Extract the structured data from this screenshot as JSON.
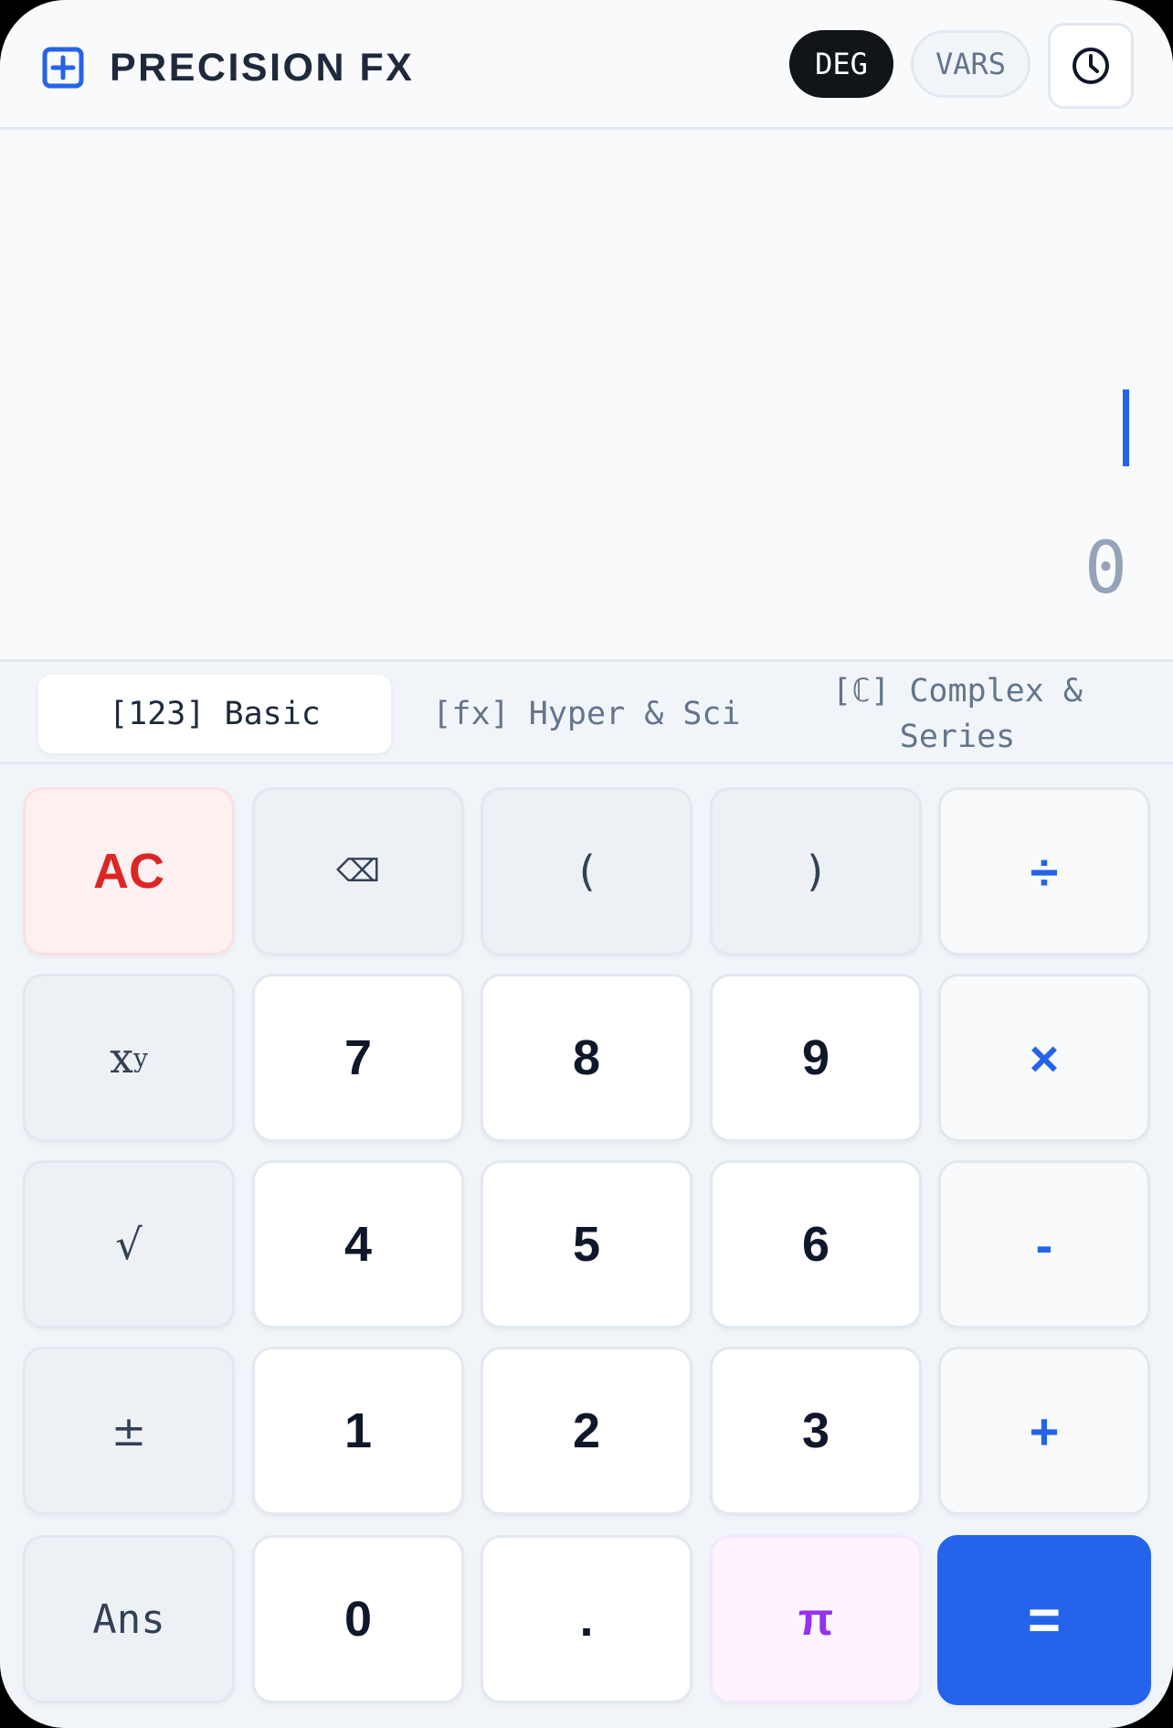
{
  "header": {
    "title": "PRECISION FX",
    "logo_icon": "plus-square-icon",
    "angle_mode": "DEG",
    "vars_label": "VARS",
    "history_icon": "clock-icon"
  },
  "display": {
    "expression": "",
    "result": "0"
  },
  "tabs": [
    {
      "label": "[123] Basic",
      "active": true
    },
    {
      "label": "[fx] Hyper & Sci",
      "active": false
    },
    {
      "label": "[ℂ] Complex & Series",
      "active": false
    }
  ],
  "keys": {
    "ac": "AC",
    "backspace": "⌫",
    "open_paren": "(",
    "close_paren": ")",
    "divide": "÷",
    "power_base": "x",
    "power_exp": "y",
    "seven": "7",
    "eight": "8",
    "nine": "9",
    "multiply": "×",
    "sqrt": "√",
    "four": "4",
    "five": "5",
    "six": "6",
    "minus": "-",
    "plus_minus": "±",
    "one": "1",
    "two": "2",
    "three": "3",
    "plus": "+",
    "ans": "Ans",
    "zero": "0",
    "dot": ".",
    "pi": "π",
    "equals": "="
  },
  "colors": {
    "accent": "#2563eb",
    "danger": "#dc2626",
    "constant": "#9333ea",
    "dark_pill": "#111418"
  }
}
